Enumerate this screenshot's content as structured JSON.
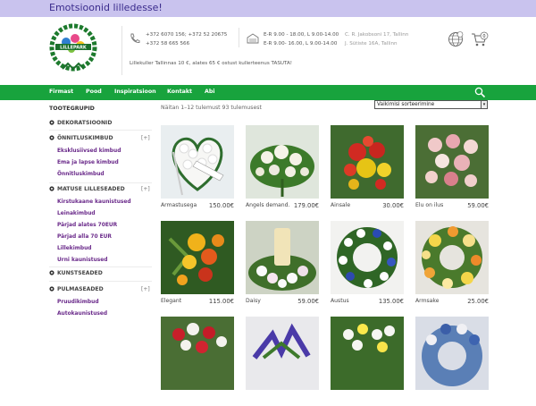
{
  "banner": {
    "text": "Emotsioonid lilledesse!"
  },
  "header": {
    "logo_text": "LILLEPARK",
    "phones": [
      "+372 6070 156; +372 52 20675",
      "+372 58 665 566"
    ],
    "hours": [
      "E-R 9.00 - 18.00, L 9.00-14.00",
      "E-R 9.00- 16.00, L 9.00-14.00"
    ],
    "addresses": [
      "C. R. Jakobsoni 17, Tallinn",
      "J. Sütiste 16A, Tallinn"
    ],
    "tagline": "Lillekuller Tallinnas 10 €, alates 65 € ostust kullerteenus TASUTA!",
    "cart_count": "0",
    "colors": {
      "banner": "#c9c3ee",
      "nav": "#18a33d",
      "accent_purple": "#6a2a8a"
    }
  },
  "nav": {
    "items": [
      "Firmast",
      "Pood",
      "Inspiratsioon",
      "Kontakt",
      "Abi"
    ]
  },
  "sidebar": {
    "title": "TOOTEGRUPID",
    "categories": [
      {
        "label": "DEKORATSIOONID",
        "expand": ""
      },
      {
        "label": "ÕNNITLUSKIMBUD",
        "expand": "[+]"
      },
      {
        "label": "MATUSE LILLESEADED",
        "expand": "[+]"
      },
      {
        "label": "KUNSTSEADED",
        "expand": ""
      },
      {
        "label": "PULMASEADED",
        "expand": "[+]"
      }
    ],
    "sub_onnitlus": [
      "Eksklusiivsed kimbud",
      "Ema ja lapse kimbud",
      "Õnnitluskimbud"
    ],
    "sub_matuse": [
      "Kirstukaane kaunistused",
      "Leinakimbud",
      "Pärjad alates 70EUR",
      "Pärjad alla 70 EUR",
      "Lillekimbud",
      "Urni kaunistused"
    ],
    "sub_pulma": [
      "Pruudikimbud",
      "Autokaunistused"
    ]
  },
  "main": {
    "results_text": "Näitan 1–12 tulemust 93 tulemusest",
    "sort_label": "Vaikimisi sorteerimine",
    "products": [
      {
        "name": "Armastusega",
        "price": "150.00€"
      },
      {
        "name": "Angels demand…",
        "price": "179.00€"
      },
      {
        "name": "Ainsale",
        "price": "30.00€"
      },
      {
        "name": "Elu on ilus",
        "price": "59.00€"
      },
      {
        "name": "Elegant",
        "price": "115.00€"
      },
      {
        "name": "Daisy",
        "price": "59.00€"
      },
      {
        "name": "Austus",
        "price": "135.00€"
      },
      {
        "name": "Armsake",
        "price": "25.00€"
      }
    ]
  }
}
